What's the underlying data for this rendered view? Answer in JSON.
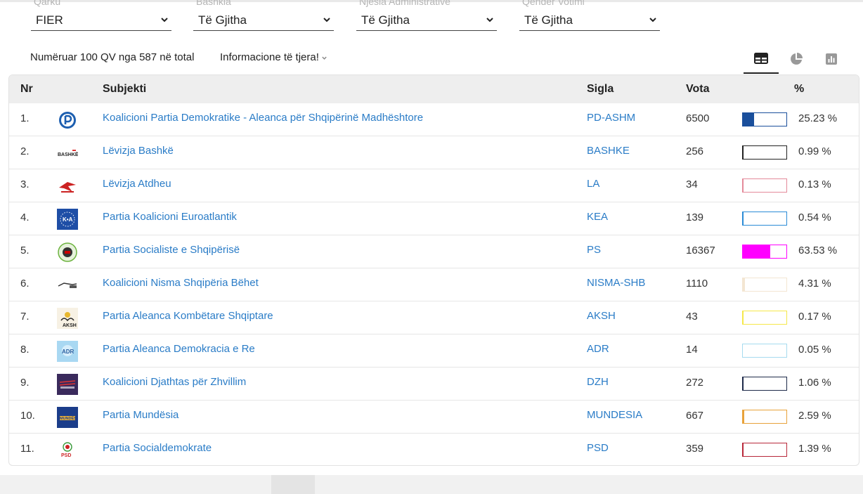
{
  "filters": [
    {
      "label": "Qarku",
      "value": "FIER"
    },
    {
      "label": "Bashkia",
      "value": "Të Gjitha"
    },
    {
      "label": "Njësia Administrative",
      "value": "Të Gjitha"
    },
    {
      "label": "Qendër Votimi",
      "value": "Të Gjitha"
    }
  ],
  "summary": "Numëruar 100 QV nga 587 në total",
  "more_info": "Informacione të tjera!",
  "view_tabs": [
    {
      "icon": "table-icon",
      "active": true
    },
    {
      "icon": "pie-chart-icon",
      "active": false
    },
    {
      "icon": "bar-chart-icon",
      "active": false
    }
  ],
  "table": {
    "headers": {
      "nr": "Nr",
      "subject": "Subjekti",
      "sigla": "Sigla",
      "votes": "Vota",
      "pct": "%"
    },
    "rows": [
      {
        "nr": "1.",
        "subject": "Koalicioni Partia Demokratike - Aleanca për Shqipërinë Madhështore",
        "sigla": "PD-ASHM",
        "votes": "6500",
        "pct": "25.23 %",
        "share": 25.23,
        "color": "#1a4f9c",
        "logo": "pd-logo"
      },
      {
        "nr": "2.",
        "subject": "Lëvizja Bashkë",
        "sigla": "BASHKE",
        "votes": "256",
        "pct": "0.99 %",
        "share": 0.99,
        "color": "#222222",
        "logo": "bashke-logo"
      },
      {
        "nr": "3.",
        "subject": "Lëvizja Atdheu",
        "sigla": "LA",
        "votes": "34",
        "pct": "0.13 %",
        "share": 0.13,
        "color": "#e48a9a",
        "logo": "la-logo"
      },
      {
        "nr": "4.",
        "subject": "Partia Koalicioni Euroatlantik",
        "sigla": "KEA",
        "votes": "139",
        "pct": "0.54 %",
        "share": 0.54,
        "color": "#2a8bd6",
        "logo": "kea-logo"
      },
      {
        "nr": "5.",
        "subject": "Partia Socialiste e Shqipërisë",
        "sigla": "PS",
        "votes": "16367",
        "pct": "63.53 %",
        "share": 63.53,
        "color": "#ff00ff",
        "logo": "ps-logo"
      },
      {
        "nr": "6.",
        "subject": "Koalicioni Nisma Shqipëria Bëhet",
        "sigla": "NISMA-SHB",
        "votes": "1110",
        "pct": "4.31 %",
        "share": 4.31,
        "color": "#f3e6d2",
        "logo": "nisma-logo"
      },
      {
        "nr": "7.",
        "subject": "Partia Aleanca Kombëtare Shqiptare",
        "sigla": "AKSH",
        "votes": "43",
        "pct": "0.17 %",
        "share": 0.17,
        "color": "#f5e84a",
        "logo": "aksh-logo"
      },
      {
        "nr": "8.",
        "subject": "Partia Aleanca Demokracia e Re",
        "sigla": "ADR",
        "votes": "14",
        "pct": "0.05 %",
        "share": 0.05,
        "color": "#a6dbef",
        "logo": "adr-logo"
      },
      {
        "nr": "9.",
        "subject": "Koalicioni Djathtas për Zhvillim",
        "sigla": "DZH",
        "votes": "272",
        "pct": "1.06 %",
        "share": 1.06,
        "color": "#1e2a4a",
        "logo": "dzh-logo"
      },
      {
        "nr": "10.",
        "subject": "Partia Mundësia",
        "sigla": "MUNDESIA",
        "votes": "667",
        "pct": "2.59 %",
        "share": 2.59,
        "color": "#e8a23a",
        "logo": "mundesia-logo"
      },
      {
        "nr": "11.",
        "subject": "Partia Socialdemokrate",
        "sigla": "PSD",
        "votes": "359",
        "pct": "1.39 %",
        "share": 1.39,
        "color": "#b8283a",
        "logo": "psd-logo"
      }
    ]
  }
}
